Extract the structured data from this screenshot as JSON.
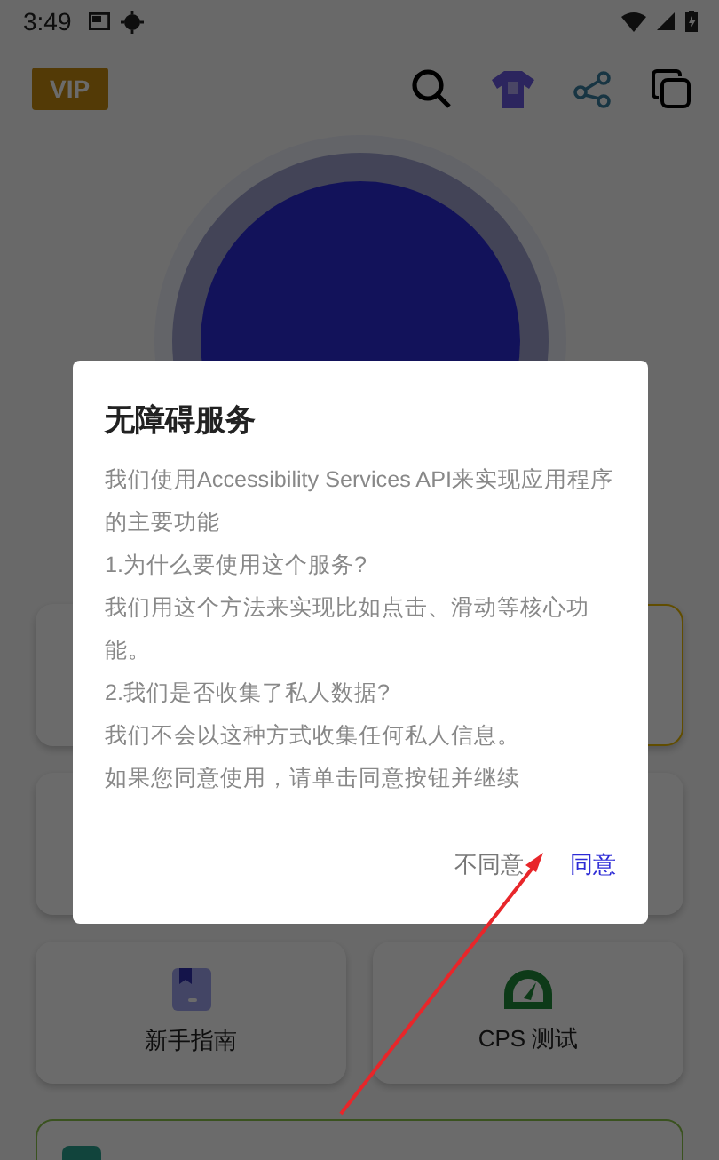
{
  "status_bar": {
    "time": "3:49"
  },
  "top_bar": {
    "vip_badge": "VIP"
  },
  "start_button": {
    "kind": "round"
  },
  "hidden_cards": [
    {
      "highlighted": false
    },
    {
      "highlighted": true
    },
    {
      "highlighted": false
    },
    {
      "highlighted": false
    }
  ],
  "tool_cards": [
    {
      "kind": "guide",
      "label": "新手指南"
    },
    {
      "kind": "gauge",
      "label": "CPS 测试"
    }
  ],
  "backup_card": {
    "kind": "section"
  },
  "dialog": {
    "title": "无障碍服务",
    "paragraphs": [
      "我们使用Accessibility Services API来实现应用程序的主要功能",
      "1.为什么要使用这个服务?",
      "我们用这个方法来实现比如点击、滑动等核心功能。",
      "2.我们是否收集了私人数据?",
      "我们不会以这种方式收集任何私人信息。",
      "如果您同意使用，请单击同意按钮并继续"
    ],
    "buttons": [
      {
        "label": "不同意",
        "primary": false
      },
      {
        "label": "同意",
        "primary": true
      }
    ]
  }
}
